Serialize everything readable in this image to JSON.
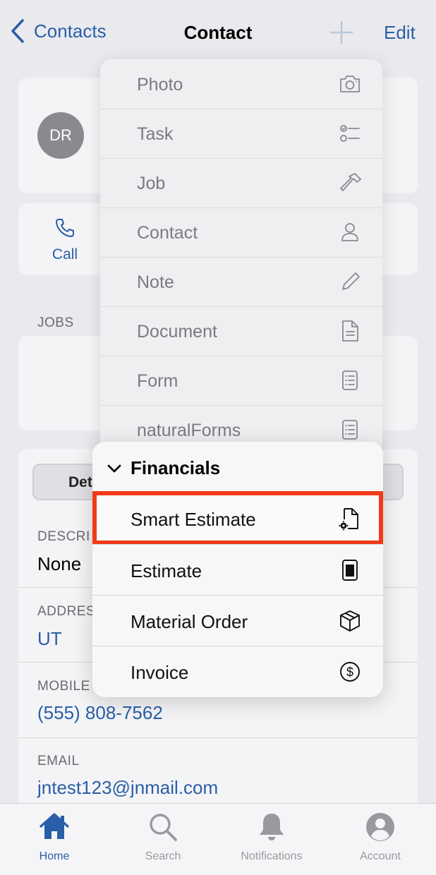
{
  "nav": {
    "back_label": "Contacts",
    "title": "Contact",
    "edit_label": "Edit"
  },
  "contact": {
    "initials": "DR"
  },
  "actions": {
    "call_label": "Call"
  },
  "sections": {
    "jobs": "JOBS"
  },
  "tabs_segment": {
    "details_partial": "Det"
  },
  "fields": [
    {
      "label": "DESCRI",
      "value": "None"
    },
    {
      "label": "ADDRES",
      "value": "UT"
    },
    {
      "label": "MOBILE",
      "value": "(555) 808-7562"
    },
    {
      "label": "EMAIL",
      "value": "jntest123@jnmail.com"
    }
  ],
  "menu": {
    "items": [
      {
        "label": "Photo",
        "icon": "camera-icon"
      },
      {
        "label": "Task",
        "icon": "checklist-icon"
      },
      {
        "label": "Job",
        "icon": "hammer-icon"
      },
      {
        "label": "Contact",
        "icon": "person-icon"
      },
      {
        "label": "Note",
        "icon": "pencil-icon"
      },
      {
        "label": "Document",
        "icon": "document-icon"
      },
      {
        "label": "Form",
        "icon": "form-icon"
      },
      {
        "label": "naturalForms",
        "icon": "form-icon"
      }
    ],
    "financials": {
      "header": "Financials",
      "items": [
        {
          "label": "Smart Estimate",
          "icon": "smart-estimate-icon"
        },
        {
          "label": "Estimate",
          "icon": "estimate-icon"
        },
        {
          "label": "Material Order",
          "icon": "box-icon"
        },
        {
          "label": "Invoice",
          "icon": "dollar-icon"
        }
      ]
    }
  },
  "tabbar": {
    "home": "Home",
    "search": "Search",
    "notifications": "Notifications",
    "account": "Account"
  },
  "colors": {
    "accent": "#2a5ea8",
    "highlight": "#f03a17"
  }
}
